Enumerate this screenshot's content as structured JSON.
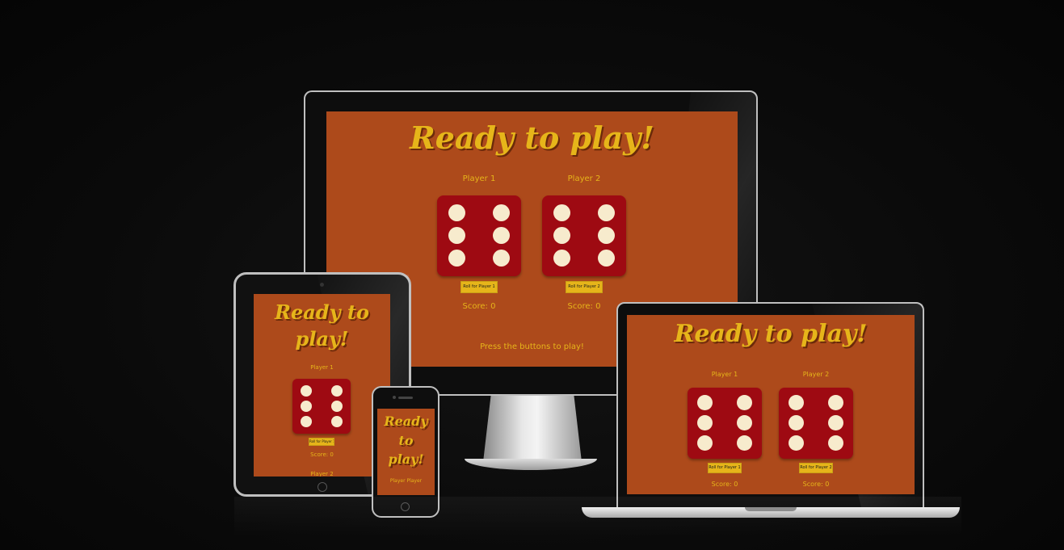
{
  "title": "Ready to play!",
  "title_lines": [
    "Ready to",
    "play!"
  ],
  "phone_title_lines": [
    "Ready",
    "to",
    "play!"
  ],
  "player1_label": "Player 1",
  "player2_label": "Player 2",
  "roll_button_1": "Roll for Player 1",
  "roll_button_2": "Roll for Player 2",
  "score_1": "Score: 0",
  "score_2": "Score: 0",
  "message": "Press the buttons to play!",
  "phone_players": "Player Player",
  "dice_value_player1": 6,
  "dice_value_player2": 6,
  "colors": {
    "background": "#ad4a1b",
    "accent": "#e6b51a",
    "die": "#9e0a12",
    "pip": "#f7ebcd",
    "page_background": "#0a0a0a"
  }
}
